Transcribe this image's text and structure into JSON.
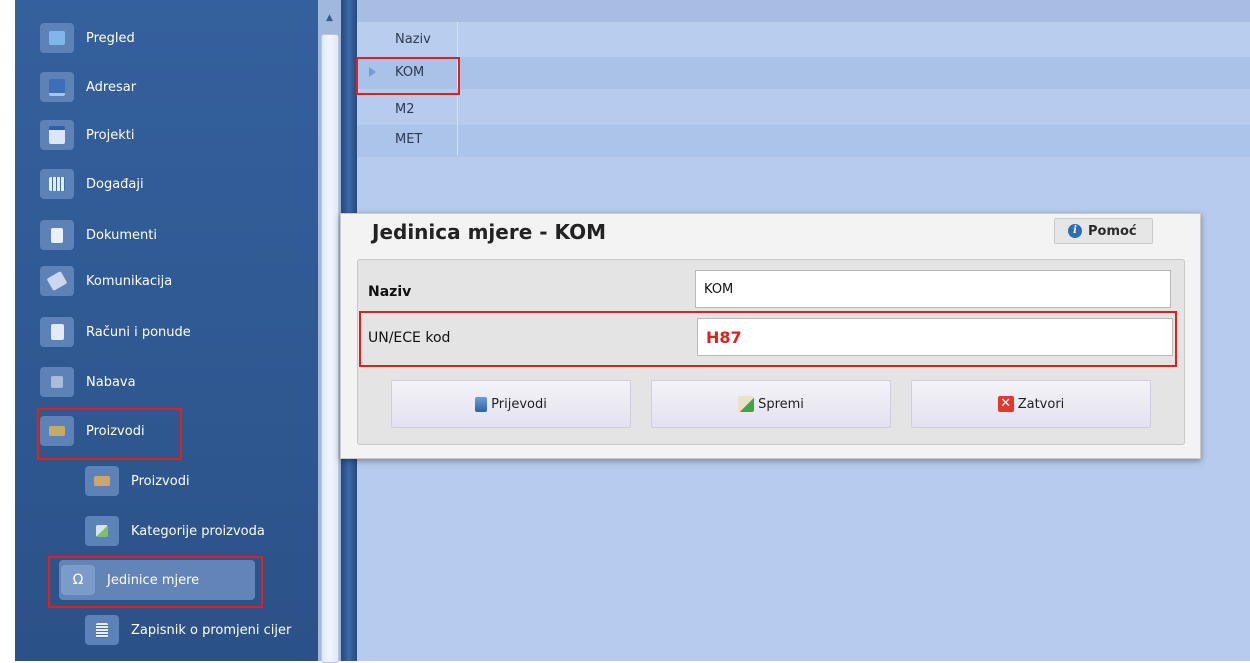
{
  "sidebar": {
    "items": [
      {
        "label": "Pregled",
        "icon": "overview-icon"
      },
      {
        "label": "Adresar",
        "icon": "address-book-icon"
      },
      {
        "label": "Projekti",
        "icon": "projects-icon"
      },
      {
        "label": "Događaji",
        "icon": "calendar-icon"
      },
      {
        "label": "Dokumenti",
        "icon": "documents-icon"
      },
      {
        "label": "Komunikacija",
        "icon": "phone-icon"
      },
      {
        "label": "Računi i ponude",
        "icon": "invoice-icon"
      },
      {
        "label": "Nabava",
        "icon": "procurement-icon"
      },
      {
        "label": "Proizvodi",
        "icon": "products-icon"
      }
    ],
    "subitems": [
      {
        "label": "Proizvodi",
        "icon": "products-icon"
      },
      {
        "label": "Kategorije proizvoda",
        "icon": "categories-icon"
      },
      {
        "label": "Jedinice mjere",
        "icon": "omega-icon",
        "glyph": "Ω"
      },
      {
        "label": "Zapisnik o promjeni cijer",
        "icon": "price-log-icon"
      }
    ]
  },
  "grid": {
    "column": "Naziv",
    "rows": [
      "KOM",
      "M2",
      "MET"
    ],
    "selected_row": "KOM"
  },
  "dialog": {
    "title": "Jedinica mjere - KOM",
    "help_label": "Pomoć",
    "fields": {
      "naziv_label": "Naziv",
      "naziv_value": "KOM",
      "unece_label": "UN/ECE kod",
      "unece_value": "H87"
    },
    "buttons": {
      "translations": "Prijevodi",
      "save": "Spremi",
      "close": "Zatvori"
    }
  },
  "colors": {
    "sidebar": "#2f5891",
    "grid_background": "#b6cbee",
    "highlight": "#e0201c",
    "unece_value": "#e0201c"
  }
}
